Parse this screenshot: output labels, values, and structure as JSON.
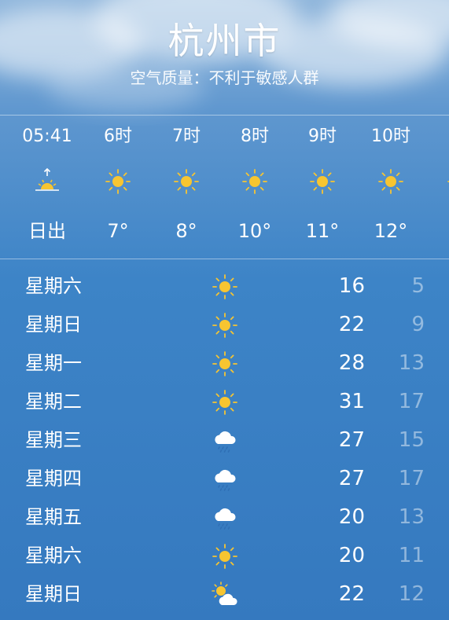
{
  "header": {
    "city": "杭州市",
    "air_quality": "空气质量：不利于敏感人群"
  },
  "hourly": [
    {
      "time": "05:41",
      "icon": "sunrise-icon",
      "value": "日出"
    },
    {
      "time": "6时",
      "icon": "sun-icon",
      "value": "7°"
    },
    {
      "time": "7时",
      "icon": "sun-icon",
      "value": "8°"
    },
    {
      "time": "8时",
      "icon": "sun-icon",
      "value": "10°"
    },
    {
      "time": "9时",
      "icon": "sun-icon",
      "value": "11°"
    },
    {
      "time": "10时",
      "icon": "sun-icon",
      "value": "12°"
    },
    {
      "time": "1",
      "icon": "sun-icon",
      "value": "1"
    }
  ],
  "daily": [
    {
      "day": "星期六",
      "icon": "sun-icon",
      "high": "16",
      "low": "5"
    },
    {
      "day": "星期日",
      "icon": "sun-icon",
      "high": "22",
      "low": "9"
    },
    {
      "day": "星期一",
      "icon": "sun-icon",
      "high": "28",
      "low": "13"
    },
    {
      "day": "星期二",
      "icon": "sun-icon",
      "high": "31",
      "low": "17"
    },
    {
      "day": "星期三",
      "icon": "rain-cloud-icon",
      "high": "27",
      "low": "15"
    },
    {
      "day": "星期四",
      "icon": "rain-cloud-icon",
      "high": "27",
      "low": "17"
    },
    {
      "day": "星期五",
      "icon": "rain-cloud-icon",
      "high": "20",
      "low": "13"
    },
    {
      "day": "星期六",
      "icon": "sun-icon",
      "high": "20",
      "low": "11"
    },
    {
      "day": "星期日",
      "icon": "partly-cloudy-icon",
      "high": "22",
      "low": "12"
    }
  ],
  "colors": {
    "sun": "#f7c531",
    "cloud": "#ffffff",
    "rain": "#2f6fb5",
    "low_temp": "rgba(255,255,255,0.45)"
  }
}
